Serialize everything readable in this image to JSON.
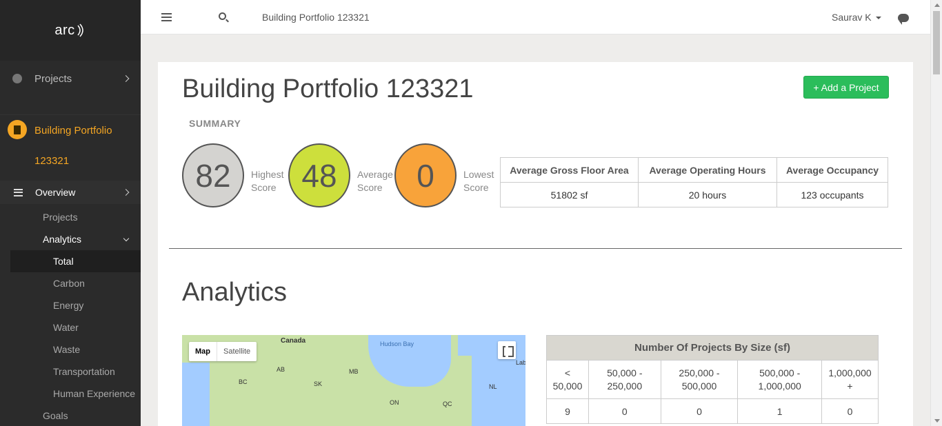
{
  "sidebar": {
    "logo": "arc",
    "projects_label": "Projects",
    "portfolio_line1": "Building Portfolio",
    "portfolio_line2": "123321",
    "overview_label": "Overview",
    "items": [
      {
        "label": "Projects"
      },
      {
        "label": "Analytics"
      },
      {
        "label": "Total"
      },
      {
        "label": "Carbon"
      },
      {
        "label": "Energy"
      },
      {
        "label": "Water"
      },
      {
        "label": "Waste"
      },
      {
        "label": "Transportation"
      },
      {
        "label": "Human Experience"
      },
      {
        "label": "Goals"
      }
    ]
  },
  "topbar": {
    "title": "Building Portfolio 123321",
    "user": "Saurav K"
  },
  "main": {
    "title": "Building Portfolio 123321",
    "add_button": "+ Add a Project",
    "summary_label": "SUMMARY",
    "scores": [
      {
        "value": "82",
        "label1": "Highest",
        "label2": "Score",
        "color": "#d4d3d0"
      },
      {
        "value": "48",
        "label1": "Average",
        "label2": "Score",
        "color": "#cddf3c"
      },
      {
        "value": "0",
        "label1": "Lowest",
        "label2": "Score",
        "color": "#f8a33a"
      }
    ],
    "averages": {
      "headers": [
        "Average Gross Floor Area",
        "Average Operating Hours",
        "Average Occupancy"
      ],
      "values": [
        "51802 sf",
        "20 hours",
        "123 occupants"
      ]
    },
    "analytics_title": "Analytics",
    "map": {
      "map_btn": "Map",
      "satellite_btn": "Satellite",
      "labels": [
        "Canada",
        "Hudson Bay",
        "AB",
        "BC",
        "SK",
        "MB",
        "ON",
        "QC",
        "NL",
        "Lab"
      ]
    },
    "size_table": {
      "caption": "Number Of Projects By Size (sf)",
      "headers": [
        [
          "<",
          "50,000"
        ],
        [
          "50,000 -",
          "250,000"
        ],
        [
          "250,000 -",
          "500,000"
        ],
        [
          "500,000 -",
          "1,000,000"
        ],
        [
          "1,000,000",
          "+"
        ]
      ],
      "values": [
        "9",
        "0",
        "0",
        "1",
        "0"
      ]
    }
  }
}
